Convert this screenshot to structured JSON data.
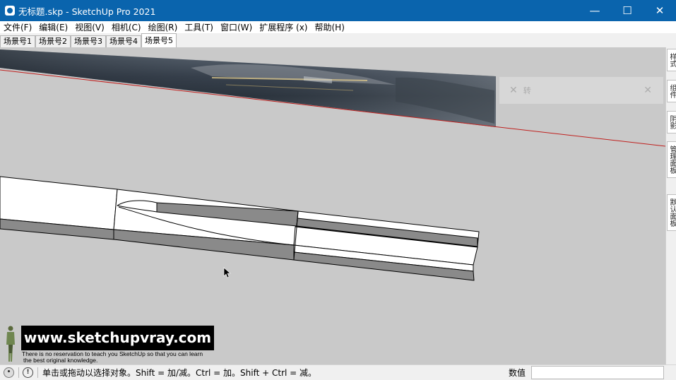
{
  "window": {
    "title": "无标题.skp - SketchUp Pro 2021",
    "minimize": "—",
    "maximize": "☐",
    "close": "✕"
  },
  "menu": [
    "文件(F)",
    "编辑(E)",
    "视图(V)",
    "相机(C)",
    "绘图(R)",
    "工具(T)",
    "窗口(W)",
    "扩展程序 (x)",
    "帮助(H)"
  ],
  "scenes": [
    {
      "label": "场景号1",
      "active": false
    },
    {
      "label": "场景号2",
      "active": false
    },
    {
      "label": "场景号3",
      "active": false
    },
    {
      "label": "场景号4",
      "active": false
    },
    {
      "label": "场景号5",
      "active": true
    }
  ],
  "float_panel": {
    "text": "转"
  },
  "tray": [
    "样式",
    "组件",
    "阴影",
    "管理面板",
    "默认面板"
  ],
  "watermark": {
    "url": "www.sketchupvray.com",
    "line1": "There is no reservation to teach you SketchUp so that you can learn",
    "line2": "the best original knowledge."
  },
  "status": {
    "message": "单击或拖动以选择对象。Shift = 加/减。Ctrl = 加。Shift + Ctrl = 减。",
    "measurements_label": "数值",
    "measurements_value": ""
  },
  "colors": {
    "titlebar": "#0a64ad",
    "viewport": "#c9c9c9",
    "edge_red": "#c0201e"
  }
}
